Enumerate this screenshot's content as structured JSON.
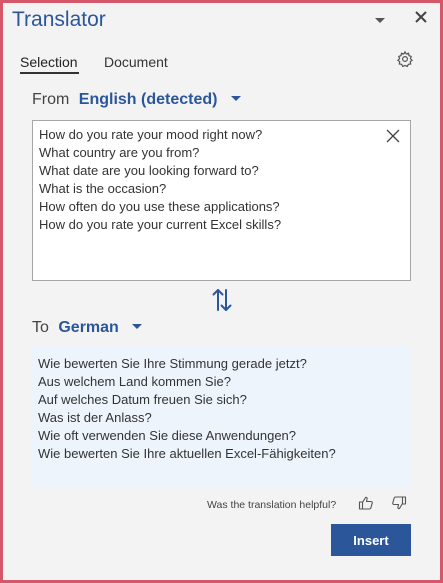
{
  "header": {
    "title": "Translator",
    "menu_icon": "caret-down-icon",
    "close_icon": "close-icon"
  },
  "tabs": [
    {
      "label": "Selection",
      "active": true
    },
    {
      "label": "Document",
      "active": false
    }
  ],
  "settings_icon": "gear-icon",
  "source": {
    "label": "From",
    "language": "English (detected)",
    "lines": [
      "How do you rate your mood right now?",
      "What country are you from?",
      "What date are you looking forward to?",
      "What is the occasion?",
      "How often do you use these applications?",
      "How do you rate your current Excel skills?"
    ],
    "clear_icon": "close-icon"
  },
  "swap_icon": "swap-arrows-icon",
  "target": {
    "label": "To",
    "language": "German",
    "lines": [
      "Wie bewerten Sie Ihre Stimmung gerade jetzt?",
      "Aus welchem Land kommen Sie?",
      "Auf welches Datum freuen Sie sich?",
      "Was ist der Anlass?",
      "Wie oft verwenden Sie diese Anwendungen?",
      "Wie bewerten Sie Ihre aktuellen Excel-Fähigkeiten?"
    ]
  },
  "feedback": {
    "prompt": "Was the translation helpful?",
    "thumbs_up_icon": "thumbs-up-icon",
    "thumbs_down_icon": "thumbs-down-icon"
  },
  "actions": {
    "insert_label": "Insert"
  },
  "colors": {
    "accent": "#2b579a",
    "frame": "#d4576a",
    "pane_background": "#f3f3f3",
    "target_background": "#eef4fc"
  }
}
